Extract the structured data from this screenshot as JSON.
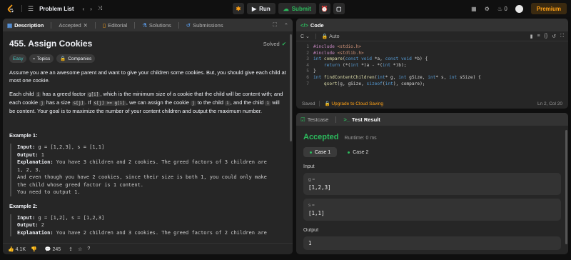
{
  "topbar": {
    "title": "Problem List",
    "run_label": "Run",
    "submit_label": "Submit",
    "streak": "0",
    "premium_label": "Premium"
  },
  "description_panel": {
    "tabs": [
      "Description",
      "Accepted",
      "Editorial",
      "Solutions",
      "Submissions"
    ],
    "title": "455. Assign Cookies",
    "status": "Solved",
    "tags": [
      "Easy",
      "Topics",
      "Companies"
    ],
    "para1": "Assume you are an awesome parent and want to give your children some cookies. But, you should give each child at most one cookie.",
    "para2": {
      "t1": "Each child ",
      "c1": "i",
      "t2": " has a greed factor ",
      "c2": "g[i]",
      "t3": ", which is the minimum size of a cookie that the child will be content with; and each cookie ",
      "c3": "j",
      "t4": " has a size ",
      "c4": "s[j]",
      "t5": ". If ",
      "c5": "s[j] >= g[i]",
      "t6": ", we can assign the cookie ",
      "c6": "j",
      "t7": " to the child ",
      "c7": "i",
      "t8": ", and the child ",
      "c8": "i",
      "t9": " will be content. Your goal is to maximize the number of your content children and output the maximum number."
    },
    "example1": {
      "heading": "Example 1:",
      "input_label": "Input:",
      "input": " g = [1,2,3], s = [1,1]",
      "output_label": "Output:",
      "output": " 1",
      "explanation_label": "Explanation:",
      "explanation": " You have 3 children and 2 cookies. The greed factors of 3 children are\n1, 2, 3.\nAnd even though you have 2 cookies, since their size is both 1, you could only make\nthe child whose greed factor is 1 content.\nYou need to output 1."
    },
    "example2": {
      "heading": "Example 2:",
      "input_label": "Input:",
      "input": " g = [1,2], s = [1,2,3]",
      "output_label": "Output:",
      "output": " 2",
      "explanation_label": "Explanation:",
      "explanation": " You have 2 children and 3 cookies. The greed factors of 2 children are"
    },
    "footer": {
      "likes": "4.1K",
      "comments": "245"
    }
  },
  "code_panel": {
    "title": "Code",
    "language": "C",
    "mode": "Auto",
    "lines": [
      {
        "n": "1",
        "parts": [
          [
            "inc",
            "#include "
          ],
          [
            "ang",
            "<stdio.h>"
          ]
        ]
      },
      {
        "n": "2",
        "parts": [
          [
            "inc",
            "#include "
          ],
          [
            "ang",
            "<stdlib.h>"
          ]
        ]
      },
      {
        "n": "3",
        "parts": [
          [
            "kw",
            "int "
          ],
          [
            "fn",
            "compare"
          ],
          [
            "pl",
            "("
          ],
          [
            "kw",
            "const void "
          ],
          [
            "pl",
            "*a, "
          ],
          [
            "kw",
            "const void "
          ],
          [
            "pl",
            "*b) {"
          ]
        ]
      },
      {
        "n": "4",
        "parts": [
          [
            "pl",
            "    "
          ],
          [
            "kw",
            "return "
          ],
          [
            "pl",
            "(*("
          ],
          [
            "kw",
            "int "
          ],
          [
            "pl",
            "*)a - *("
          ],
          [
            "kw",
            "int "
          ],
          [
            "pl",
            "*)b);"
          ]
        ]
      },
      {
        "n": "5",
        "parts": [
          [
            "pl",
            "}"
          ]
        ]
      },
      {
        "n": "6",
        "parts": [
          [
            "kw",
            "int "
          ],
          [
            "fn",
            "findContentChildren"
          ],
          [
            "pl",
            "("
          ],
          [
            "kw",
            "int"
          ],
          [
            "pl",
            "* g, "
          ],
          [
            "kw",
            "int "
          ],
          [
            "pl",
            "gSize, "
          ],
          [
            "kw",
            "int"
          ],
          [
            "pl",
            "* s, "
          ],
          [
            "kw",
            "int "
          ],
          [
            "pl",
            "sSize) {"
          ]
        ]
      },
      {
        "n": "7",
        "parts": [
          [
            "pl",
            "    "
          ],
          [
            "fn",
            "qsort"
          ],
          [
            "pl",
            "(g, gSize, "
          ],
          [
            "kw",
            "sizeof"
          ],
          [
            "pl",
            "("
          ],
          [
            "kw",
            "int"
          ],
          [
            "pl",
            "), compare);"
          ]
        ]
      }
    ],
    "saved": "Saved",
    "upgrade": "Upgrade to Cloud Saving",
    "cursor": "Ln 2, Col 20"
  },
  "result_panel": {
    "tabs": [
      "Testcase",
      "Test Result"
    ],
    "verdict": "Accepted",
    "runtime": "Runtime: 0 ms",
    "cases": [
      "Case 1",
      "Case 2"
    ],
    "input_label": "Input",
    "g_name": "g =",
    "g_value": "[1,2,3]",
    "s_name": "s =",
    "s_value": "[1,1]",
    "output_label": "Output",
    "output_value": "1"
  },
  "colors": {
    "accent": "#ffa116",
    "accepted": "#2cbb5d",
    "easy": "#46c6c2",
    "run": "#eff1f6",
    "submit": "#2cbb5d"
  }
}
